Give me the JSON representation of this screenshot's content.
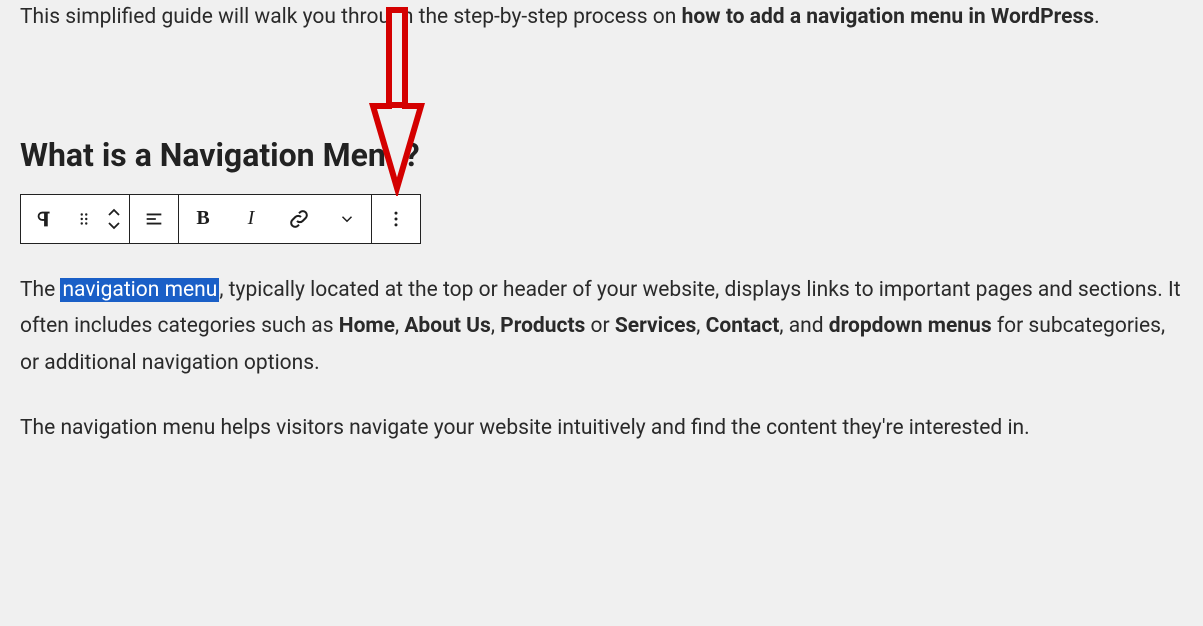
{
  "intro": {
    "prefix": "This simplified guide will walk you through the step-by-step process on ",
    "bold": "how to add a navigation menu in WordPress",
    "suffix": "."
  },
  "heading": "What is a Navigation Menu?",
  "toolbar": {
    "paragraph_icon": "paragraph-icon",
    "drag_icon": "drag-icon",
    "move_icon": "move-up-down-icon",
    "align_icon": "align-icon",
    "bold_label": "B",
    "italic_label": "I",
    "link_icon": "link-icon",
    "chevron_icon": "chevron-down-icon",
    "more_icon": "more-options-icon"
  },
  "para1": {
    "t1": "The ",
    "hl": "navigation menu",
    "t2": ", typically located at the top or header of your website, displays links to important pages and sections. It often includes categories such as ",
    "b1": "Home",
    "c1": ", ",
    "b2": "About Us",
    "c2": ", ",
    "b3": "Products",
    "c3": " or ",
    "b4": "Services",
    "c4": ", ",
    "b5": "Contact",
    "c5": ", and ",
    "b6": "dropdown menus",
    "t3": " for subcategories, or additional navigation options."
  },
  "para2": "The navigation menu helps visitors navigate your website intuitively and find the content they're interested in.",
  "annotation": {
    "arrow_color": "#d40000"
  }
}
